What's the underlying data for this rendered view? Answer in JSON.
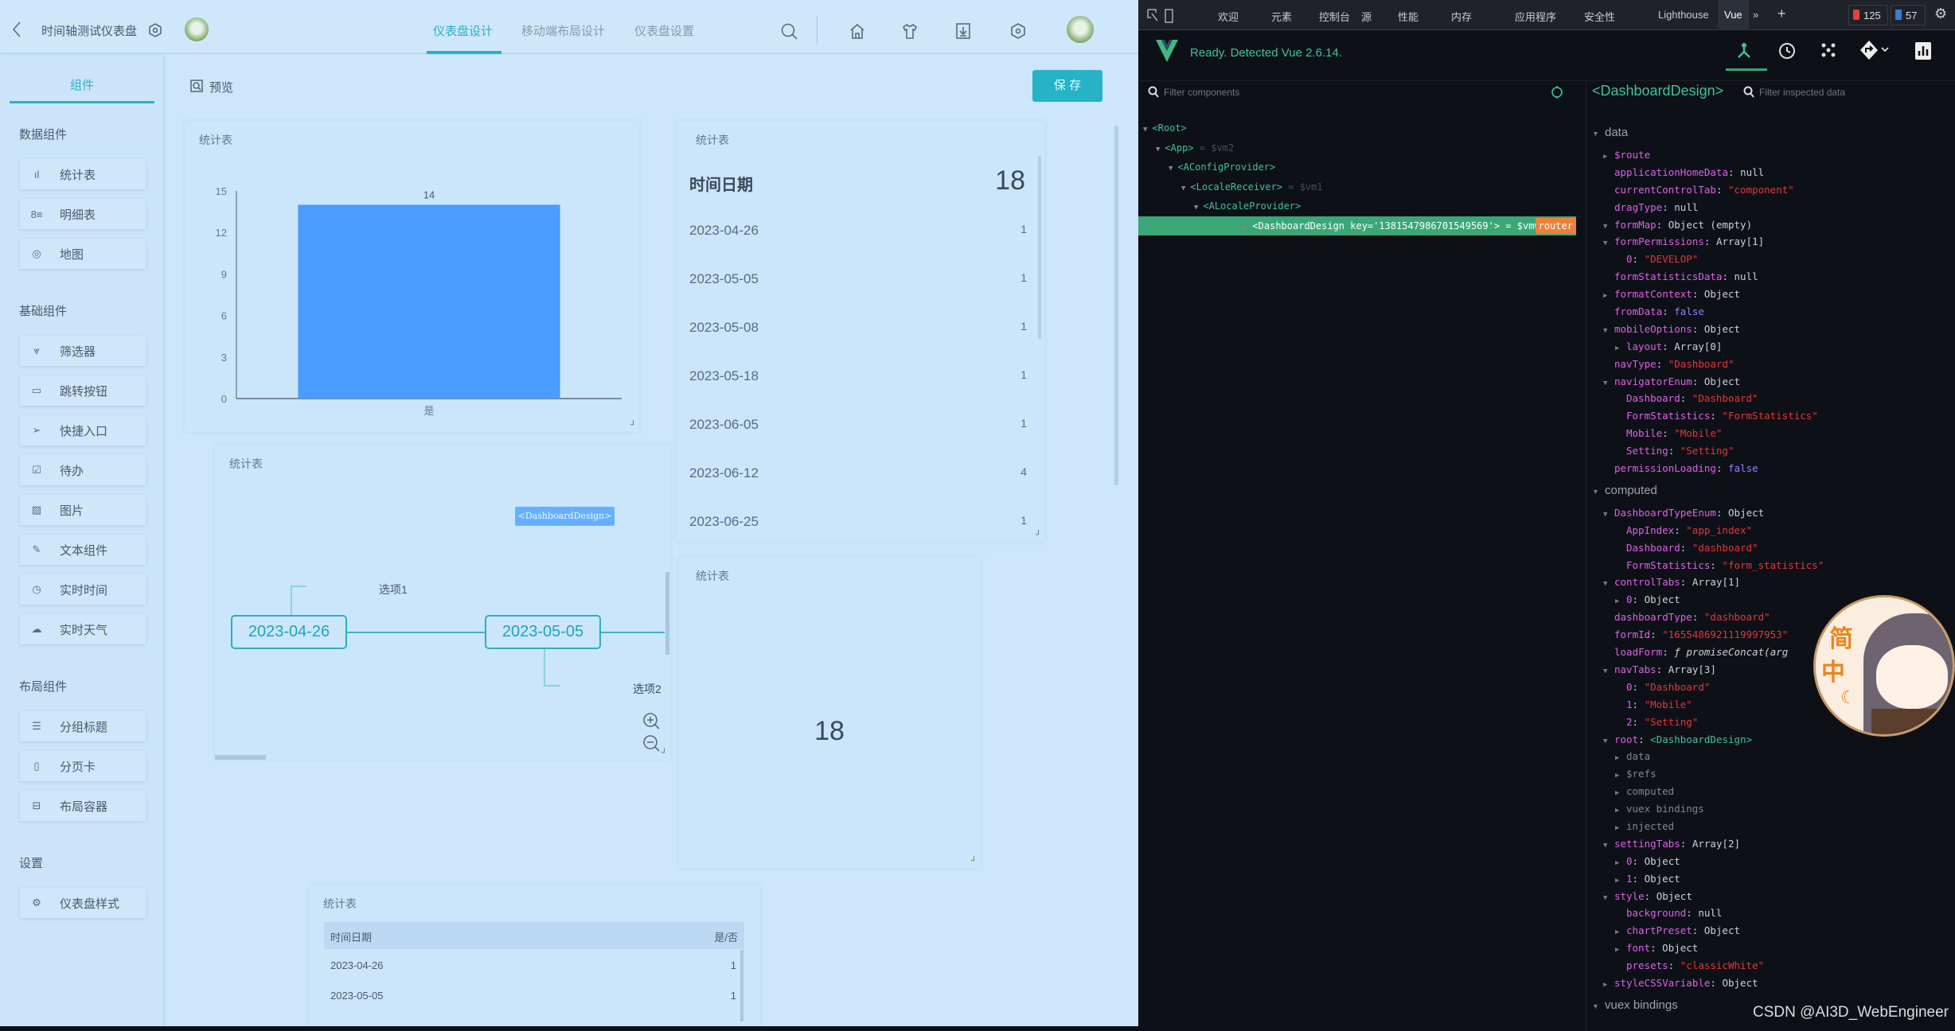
{
  "colors": {
    "accent": "#2bb0c8",
    "bar": "#4a9cff",
    "save_bg": "#26b3c6",
    "vue_green": "#3ba776",
    "router_badge": "#f07f3c"
  },
  "topbar": {
    "back_icon": "chevron-left-icon",
    "title": "时间轴测试仪表盘",
    "settings_icon": "hex-gear-icon",
    "tabs": [
      {
        "label": "仪表盘设计",
        "active": true
      },
      {
        "label": "移动端布局设计",
        "active": false
      },
      {
        "label": "仪表盘设置",
        "active": false
      }
    ],
    "icons": [
      "search-icon",
      "home-icon",
      "shirt-icon",
      "download-icon",
      "hex-gear-icon"
    ]
  },
  "sidebar": {
    "tab": "组件",
    "sections": [
      {
        "title": "数据组件",
        "items": [
          {
            "icon": "bar-chart-icon",
            "glyph": "ıl",
            "label": "统计表"
          },
          {
            "icon": "list-detail-icon",
            "glyph": "8≡",
            "label": "明细表"
          },
          {
            "icon": "map-pin-icon",
            "glyph": "◎",
            "label": "地图"
          }
        ]
      },
      {
        "title": "基础组件",
        "items": [
          {
            "icon": "filter-icon",
            "glyph": "⩔",
            "label": "筛选器"
          },
          {
            "icon": "button-icon",
            "glyph": "▭",
            "label": "跳转按钮"
          },
          {
            "icon": "send-icon",
            "glyph": "➢",
            "label": "快捷入口"
          },
          {
            "icon": "todo-icon",
            "glyph": "☑",
            "label": "待办"
          },
          {
            "icon": "image-icon",
            "glyph": "▨",
            "label": "图片"
          },
          {
            "icon": "edit-icon",
            "glyph": "✎",
            "label": "文本组件"
          },
          {
            "icon": "clock-icon",
            "glyph": "◷",
            "label": "实时时间"
          },
          {
            "icon": "cloud-icon",
            "glyph": "☁",
            "label": "实时天气"
          }
        ]
      },
      {
        "title": "布局组件",
        "items": [
          {
            "icon": "group-title-icon",
            "glyph": "☰",
            "label": "分组标题"
          },
          {
            "icon": "page-card-icon",
            "glyph": "▯",
            "label": "分页卡"
          },
          {
            "icon": "layout-container-icon",
            "glyph": "⊟",
            "label": "布局容器"
          }
        ]
      },
      {
        "title": "设置",
        "items": [
          {
            "icon": "gear-icon",
            "glyph": "⚙",
            "label": "仪表盘样式"
          }
        ]
      }
    ]
  },
  "main": {
    "preview_label": "预览",
    "save_label": "保 存",
    "bar_card": {
      "title": "统计表"
    },
    "list_card": {
      "title": "统计表",
      "header_label": "时间日期",
      "header_value": "18",
      "rows": [
        {
          "date": "2023-04-26",
          "value": "1"
        },
        {
          "date": "2023-05-05",
          "value": "1"
        },
        {
          "date": "2023-05-08",
          "value": "1"
        },
        {
          "date": "2023-05-18",
          "value": "1"
        },
        {
          "date": "2023-06-05",
          "value": "1"
        },
        {
          "date": "2023-06-12",
          "value": "4"
        },
        {
          "date": "2023-06-25",
          "value": "1"
        }
      ]
    },
    "timeline_card": {
      "title": "统计表",
      "hover_tag": "<DashboardDesign>",
      "nodes": [
        "2023-04-26",
        "2023-05-05"
      ],
      "labels": [
        "选项1",
        "选项2"
      ]
    },
    "number_card": {
      "title": "统计表",
      "value": "18"
    },
    "table_card": {
      "title": "统计表",
      "columns": [
        "时间日期",
        "是/否"
      ],
      "rows": [
        [
          "2023-04-26",
          "1"
        ],
        [
          "2023-05-05",
          "1"
        ]
      ]
    }
  },
  "chart_data": {
    "type": "bar",
    "title": "统计表",
    "categories": [
      "是"
    ],
    "values": [
      14
    ],
    "data_labels": [
      "14"
    ],
    "ylim": [
      0,
      15
    ],
    "yticks": [
      0,
      3,
      6,
      9,
      12,
      15
    ],
    "xlabel": "",
    "ylabel": "",
    "grid": false
  },
  "devtools": {
    "tabs": [
      "欢迎",
      "元素",
      "控制台",
      "源",
      "性能",
      "内存",
      "应用程序",
      "安全性",
      "Lighthouse",
      "Vue"
    ],
    "active_tab": "Vue",
    "more": "»",
    "add": "+",
    "error_count": "125",
    "message_count": "57",
    "vue_status": "Ready. Detected Vue 2.6.14.",
    "filter_components_placeholder": "Filter components",
    "filter_data_placeholder": "Filter inspected data",
    "inspected_component": "<DashboardDesign>",
    "tree": [
      {
        "label": "<Root>",
        "suffix": "",
        "arrow": "down",
        "selected": false
      },
      {
        "label": "<App>",
        "suffix": " = $vm2",
        "arrow": "down",
        "selected": false
      },
      {
        "label": "<AConfigProvider>",
        "suffix": "",
        "arrow": "down",
        "selected": false
      },
      {
        "label": "<LocaleReceiver>",
        "suffix": " = $vm1",
        "arrow": "down",
        "selected": false
      },
      {
        "label": "<ALocaleProvider>",
        "suffix": "",
        "arrow": "down",
        "selected": false
      },
      {
        "label": "<DashboardDesign key='1381547986701549569'> = $vm0",
        "suffix": "",
        "arrow": "right",
        "selected": true,
        "badge": "router"
      }
    ],
    "inspector": [
      {
        "section": "data"
      },
      {
        "indent": 0,
        "arrow": "right",
        "key": "$route",
        "gray": false
      },
      {
        "indent": 0,
        "key": "applicationHomeData",
        "value": "null",
        "vtype": "null"
      },
      {
        "indent": 0,
        "key": "currentControlTab",
        "value": "\"component\"",
        "vtype": "string"
      },
      {
        "indent": 0,
        "key": "dragType",
        "value": "null",
        "vtype": "null"
      },
      {
        "indent": 0,
        "arrow": "down",
        "key": "formMap",
        "value": "Object (empty)",
        "vtype": "obj"
      },
      {
        "indent": 0,
        "arrow": "down",
        "key": "formPermissions",
        "value": "Array[1]",
        "vtype": "obj"
      },
      {
        "indent": 1,
        "key": "0",
        "value": "\"DEVELOP\"",
        "vtype": "string"
      },
      {
        "indent": 0,
        "key": "formStatisticsData",
        "value": "null",
        "vtype": "null"
      },
      {
        "indent": 0,
        "arrow": "right",
        "key": "formatContext",
        "value": "Object",
        "vtype": "obj"
      },
      {
        "indent": 0,
        "key": "fromData",
        "value": "false",
        "vtype": "bool"
      },
      {
        "indent": 0,
        "arrow": "down",
        "key": "mobileOptions",
        "value": "Object",
        "vtype": "obj"
      },
      {
        "indent": 1,
        "arrow": "right",
        "key": "layout",
        "value": "Array[0]",
        "vtype": "obj"
      },
      {
        "indent": 0,
        "key": "navType",
        "value": "\"Dashboard\"",
        "vtype": "string"
      },
      {
        "indent": 0,
        "arrow": "down",
        "key": "navigatorEnum",
        "value": "Object",
        "vtype": "obj"
      },
      {
        "indent": 1,
        "key": "Dashboard",
        "value": "\"Dashboard\"",
        "vtype": "string"
      },
      {
        "indent": 1,
        "key": "FormStatistics",
        "value": "\"FormStatistics\"",
        "vtype": "string"
      },
      {
        "indent": 1,
        "key": "Mobile",
        "value": "\"Mobile\"",
        "vtype": "string"
      },
      {
        "indent": 1,
        "key": "Setting",
        "value": "\"Setting\"",
        "vtype": "string"
      },
      {
        "indent": 0,
        "key": "permissionLoading",
        "value": "false",
        "vtype": "bool"
      },
      {
        "section": "computed"
      },
      {
        "indent": 0,
        "arrow": "down",
        "key": "DashboardTypeEnum",
        "value": "Object",
        "vtype": "obj"
      },
      {
        "indent": 1,
        "key": "AppIndex",
        "value": "\"app_index\"",
        "vtype": "string"
      },
      {
        "indent": 1,
        "key": "Dashboard",
        "value": "\"dashboard\"",
        "vtype": "string"
      },
      {
        "indent": 1,
        "key": "FormStatistics",
        "value": "\"form_statistics\"",
        "vtype": "string"
      },
      {
        "indent": 0,
        "arrow": "down",
        "key": "controlTabs",
        "value": "Array[1]",
        "vtype": "obj"
      },
      {
        "indent": 1,
        "arrow": "right",
        "key": "0",
        "value": "Object",
        "vtype": "obj"
      },
      {
        "indent": 0,
        "key": "dashboardType",
        "value": "\"dashboard\"",
        "vtype": "string"
      },
      {
        "indent": 0,
        "key": "formId",
        "value": "\"1655486921119997953\"",
        "vtype": "string"
      },
      {
        "indent": 0,
        "key": "loadForm",
        "value": "ƒ promiseConcat(arg",
        "vtype": "fn"
      },
      {
        "indent": 0,
        "arrow": "down",
        "key": "navTabs",
        "value": "Array[3]",
        "vtype": "obj"
      },
      {
        "indent": 1,
        "key": "0",
        "value": "\"Dashboard\"",
        "vtype": "string"
      },
      {
        "indent": 1,
        "key": "1",
        "value": "\"Mobile\"",
        "vtype": "string"
      },
      {
        "indent": 1,
        "key": "2",
        "value": "\"Setting\"",
        "vtype": "string"
      },
      {
        "indent": 0,
        "arrow": "down",
        "key": "root",
        "value": "<DashboardDesign>",
        "vtype": "comp"
      },
      {
        "indent": 1,
        "arrow": "right",
        "key": "data",
        "gray": true
      },
      {
        "indent": 1,
        "arrow": "right",
        "key": "$refs",
        "gray": true
      },
      {
        "indent": 1,
        "arrow": "right",
        "key": "computed",
        "gray": true
      },
      {
        "indent": 1,
        "arrow": "right",
        "key": "vuex bindings",
        "gray": true
      },
      {
        "indent": 1,
        "arrow": "right",
        "key": "injected",
        "gray": true
      },
      {
        "indent": 0,
        "arrow": "down",
        "key": "settingTabs",
        "value": "Array[2]",
        "vtype": "obj"
      },
      {
        "indent": 1,
        "arrow": "right",
        "key": "0",
        "value": "Object",
        "vtype": "obj"
      },
      {
        "indent": 1,
        "arrow": "right",
        "key": "1",
        "value": "Object",
        "vtype": "obj"
      },
      {
        "indent": 0,
        "arrow": "down",
        "key": "style",
        "value": "Object",
        "vtype": "obj"
      },
      {
        "indent": 1,
        "key": "background",
        "value": "null",
        "vtype": "null"
      },
      {
        "indent": 1,
        "arrow": "right",
        "key": "chartPreset",
        "value": "Object",
        "vtype": "obj"
      },
      {
        "indent": 1,
        "arrow": "right",
        "key": "font",
        "value": "Object",
        "vtype": "obj"
      },
      {
        "indent": 1,
        "key": "presets",
        "value": "\"classicWhite\"",
        "vtype": "string"
      },
      {
        "indent": 0,
        "arrow": "right",
        "key": "styleCSSVariable",
        "value": "Object",
        "vtype": "obj"
      },
      {
        "section": "vuex bindings"
      }
    ]
  },
  "overlay": {
    "ime_chars": [
      "简",
      "中"
    ],
    "watermark": "CSDN @AI3D_WebEngineer"
  }
}
